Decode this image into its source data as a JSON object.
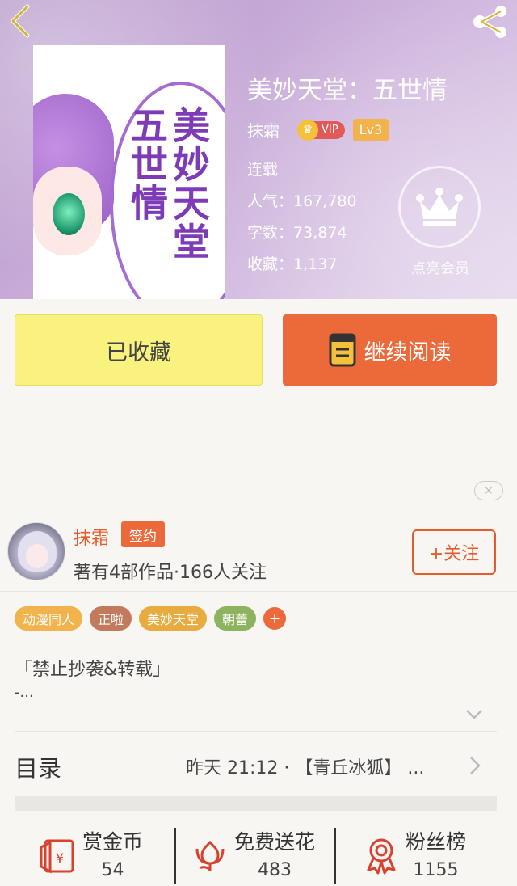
{
  "header": {
    "book_title": "美妙天堂：五世情",
    "author": "抹霜",
    "vip_label": "VIP",
    "level": "Lv3",
    "status": "连载",
    "popularity_label": "人气：",
    "popularity": "167,780",
    "word_count_label": "字数：",
    "word_count": "73,874",
    "favorites_label": "收藏：",
    "favorites": "1,137",
    "member_label": "点亮会员",
    "cover_art_text": "美妙天堂五世情"
  },
  "actions": {
    "collected_label": "已收藏",
    "continue_label": "继续阅读"
  },
  "ad": {
    "close_symbol": "×"
  },
  "author_card": {
    "name": "抹霜",
    "sign_badge": "签约",
    "info": "著有4部作品·166人关注",
    "follow_label": "+关注"
  },
  "tags": [
    {
      "label": "动漫同人",
      "color": "#f2b24c"
    },
    {
      "label": "正啦",
      "color": "#c17a5c"
    },
    {
      "label": "美妙天堂",
      "color": "#e7ab3f"
    },
    {
      "label": "朝蕾",
      "color": "#8db35f"
    }
  ],
  "tag_add": "+",
  "description": {
    "line1": "「禁止抄袭&转载」",
    "line2": "-..."
  },
  "toc": {
    "label": "目录",
    "latest": "昨天 21:12 · 【青丘冰狐】 ..."
  },
  "bottom_bar": {
    "reward": {
      "label": "赏金币",
      "count": "54"
    },
    "flowers": {
      "label": "免费送花",
      "count": "483"
    },
    "fans": {
      "label": "粉丝榜",
      "count": "1155"
    }
  },
  "colors": {
    "accent": "#ec6a3a",
    "collected_bg": "#faf27f",
    "icon_red": "#d8432f"
  }
}
